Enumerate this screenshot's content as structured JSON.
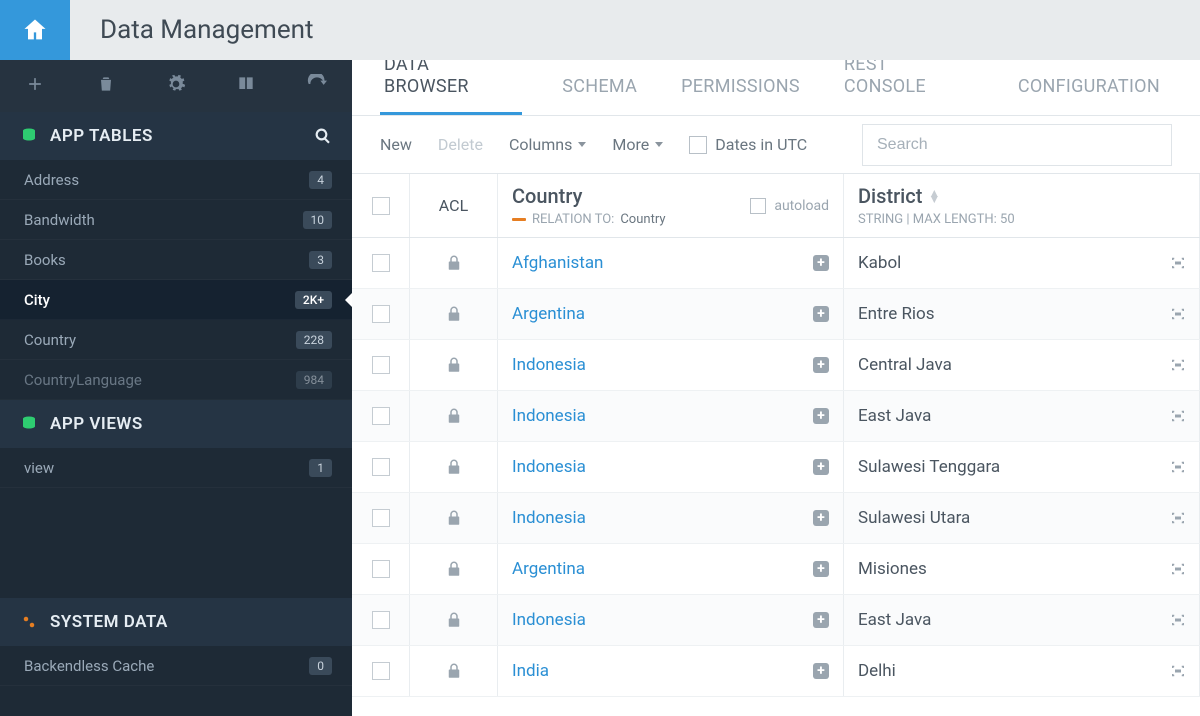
{
  "header": {
    "title": "Data Management"
  },
  "sidebar": {
    "sections": {
      "appTables": {
        "title": "APP TABLES",
        "items": [
          {
            "label": "Address",
            "count": "4",
            "active": false
          },
          {
            "label": "Bandwidth",
            "count": "10",
            "active": false
          },
          {
            "label": "Books",
            "count": "3",
            "active": false
          },
          {
            "label": "City",
            "count": "2K+",
            "active": true
          },
          {
            "label": "Country",
            "count": "228",
            "active": false
          },
          {
            "label": "CountryLanguage",
            "count": "984",
            "active": false
          }
        ]
      },
      "appViews": {
        "title": "APP VIEWS",
        "items": [
          {
            "label": "view",
            "count": "1",
            "active": false
          }
        ]
      },
      "systemData": {
        "title": "SYSTEM DATA",
        "items": [
          {
            "label": "Backendless Cache",
            "count": "0",
            "active": false
          }
        ]
      }
    }
  },
  "tabs": [
    {
      "label": "DATA BROWSER",
      "active": true
    },
    {
      "label": "SCHEMA",
      "active": false
    },
    {
      "label": "PERMISSIONS",
      "active": false
    },
    {
      "label": "REST CONSOLE",
      "active": false
    },
    {
      "label": "CONFIGURATION",
      "active": false
    }
  ],
  "toolbar": {
    "new_label": "New",
    "delete_label": "Delete",
    "columns_label": "Columns",
    "more_label": "More",
    "dates_utc_label": "Dates in UTC",
    "search_placeholder": "Search"
  },
  "columns": {
    "acl": {
      "title": "ACL"
    },
    "country": {
      "title": "Country",
      "relation_prefix": "RELATION TO:",
      "relation_target": "Country",
      "autoload_label": "autoload"
    },
    "district": {
      "title": "District",
      "meta": "STRING | MAX LENGTH: 50"
    }
  },
  "rows": [
    {
      "country": "Afghanistan",
      "district": "Kabol"
    },
    {
      "country": "Argentina",
      "district": "Entre Rios"
    },
    {
      "country": "Indonesia",
      "district": "Central Java"
    },
    {
      "country": "Indonesia",
      "district": "East Java"
    },
    {
      "country": "Indonesia",
      "district": "Sulawesi Tenggara"
    },
    {
      "country": "Indonesia",
      "district": "Sulawesi Utara"
    },
    {
      "country": "Argentina",
      "district": "Misiones"
    },
    {
      "country": "Indonesia",
      "district": "East Java"
    },
    {
      "country": "India",
      "district": "Delhi"
    }
  ]
}
